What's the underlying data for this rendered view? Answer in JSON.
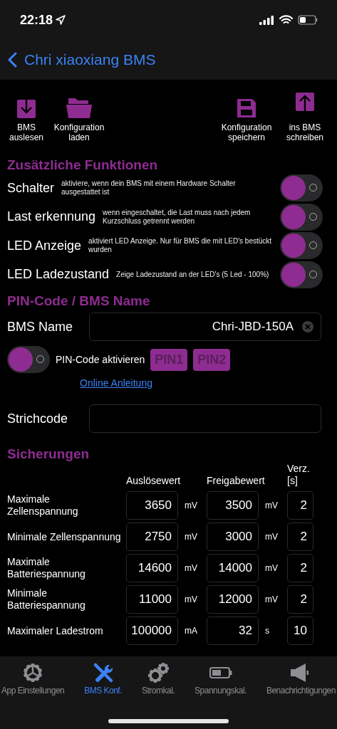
{
  "status_bar": {
    "time": "22:18"
  },
  "nav": {
    "back_title": "Chri xiaoxiang BMS"
  },
  "toolbar": [
    {
      "kind": "download",
      "label": "BMS auslesen"
    },
    {
      "kind": "folder",
      "label": "Konfiguration laden"
    },
    {
      "kind": "save",
      "label": "Konfiguration speichern"
    },
    {
      "kind": "upload",
      "label": "ins BMS schreiben"
    }
  ],
  "features": {
    "title": "Zusätzliche Funktionen",
    "rows": [
      {
        "label": "Schalter",
        "hint": "aktiviere, wenn dein BMS mit einem Hardware Schalter ausgestattet ist",
        "on": false
      },
      {
        "label": "Last erkennung",
        "hint": "wenn eingeschaltet, die Last muss nach jedem Kurzschluss getrennt werden",
        "on": false
      },
      {
        "label": "LED Anzeige",
        "hint": "aktiviert LED Anzeige. Nur für BMS die mit LED's bestückt wurden",
        "on": false
      },
      {
        "label": "LED Ladezustand",
        "hint": "Zeige Ladezustand an der LED's (5 Led - 100%)",
        "on": false
      }
    ]
  },
  "pin": {
    "title": "PIN-Code / BMS Name",
    "name_label": "BMS Name",
    "name_value": "Chri-JBD-150A",
    "pin_on": false,
    "pin_label": "PIN-Code aktivieren",
    "pin_buttons": [
      {
        "label": "PIN1",
        "disabled": true
      },
      {
        "label": "PIN2",
        "disabled": true
      }
    ],
    "link": "Online Anleitung",
    "barcode_label": "Strichcode"
  },
  "fuses": {
    "title": "Sicherungen",
    "columns": [
      "Auslösewert",
      "Freigabewert",
      "Verz. [s]"
    ],
    "rows": [
      {
        "label": "Maximale Zellenspannung",
        "trigger": "3650",
        "trigger_unit": "mV",
        "release": "3500",
        "release_unit": "mV",
        "delay": "2"
      },
      {
        "label": "Minimale Zellenspannung",
        "trigger": "2750",
        "trigger_unit": "mV",
        "release": "3000",
        "release_unit": "mV",
        "delay": "2"
      },
      {
        "label": "Maximale Batteriespannung",
        "trigger": "14600",
        "trigger_unit": "mV",
        "release": "14000",
        "release_unit": "mV",
        "delay": "2"
      },
      {
        "label": "Minimale Batteriespannung",
        "trigger": "11000",
        "trigger_unit": "mV",
        "release": "12000",
        "release_unit": "mV",
        "delay": "2"
      },
      {
        "label": "Maximaler Ladestrom",
        "trigger": "100000",
        "trigger_unit": "mA",
        "release": "32",
        "release_unit": "s",
        "delay": "10"
      }
    ]
  },
  "tabs": [
    {
      "kind": "gear",
      "label": "App Einstellungen",
      "selected": false
    },
    {
      "kind": "tools",
      "label": "BMS Konf.",
      "selected": true
    },
    {
      "kind": "gears",
      "label": "Stromkal.",
      "selected": false
    },
    {
      "kind": "battery",
      "label": "Spannungskal.",
      "selected": false
    },
    {
      "kind": "megaphone",
      "label": "Benachrichtigungen",
      "selected": false
    }
  ]
}
